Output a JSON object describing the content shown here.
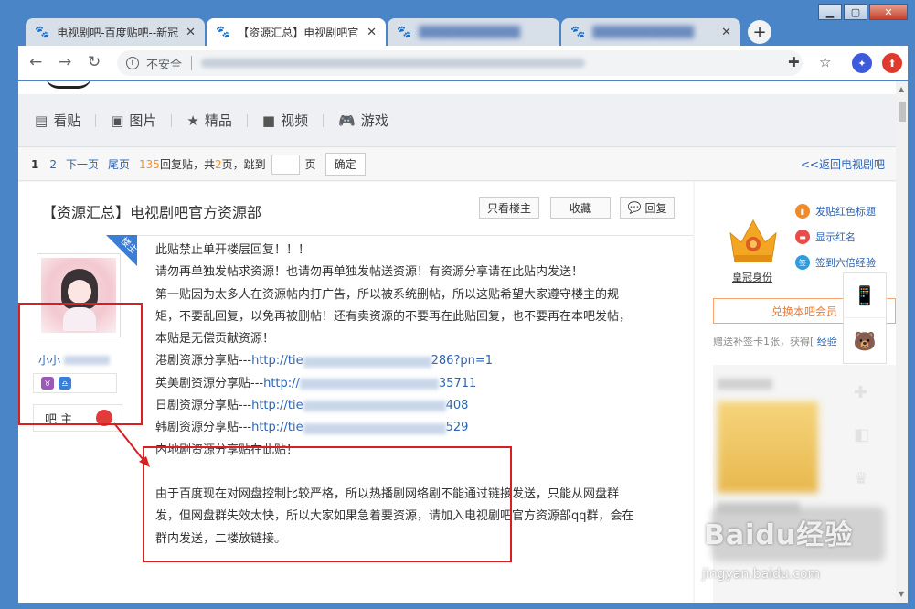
{
  "browser": {
    "tabs": [
      {
        "title": "电视剧吧-百度贴吧--新冠",
        "active": false
      },
      {
        "title": "【资源汇总】电视剧吧官",
        "active": true
      },
      {
        "title": "",
        "active": false
      },
      {
        "title": "",
        "active": false
      }
    ],
    "address": {
      "insecure_label": "不安全"
    }
  },
  "nav": {
    "items": [
      {
        "label": "看贴",
        "icon": "document-icon"
      },
      {
        "label": "图片",
        "icon": "image-icon"
      },
      {
        "label": "精品",
        "icon": "star-icon"
      },
      {
        "label": "视频",
        "icon": "video-icon"
      },
      {
        "label": "游戏",
        "icon": "gamepad-icon"
      }
    ]
  },
  "pager": {
    "page1": "1",
    "page2": "2",
    "next": "下一页",
    "last": "尾页",
    "reply_count": "135",
    "reply_text": "回复贴，共",
    "page_count": "2",
    "page_text": "页，跳到",
    "page_unit": "页",
    "confirm": "确定",
    "back": "<<返回电视剧吧"
  },
  "post": {
    "title": "【资源汇总】电视剧吧官方资源部",
    "only_op": "只看楼主",
    "favorite": "收藏",
    "reply": "回复",
    "op_tag": "楼主",
    "author_prefix": "小小",
    "role": "吧 主",
    "lines": [
      "此贴禁止单开楼层回复！！！",
      "请勿再单独发帖求资源！也请勿再单独发帖送资源！有资源分享请在此贴内发送！",
      "第一贴因为太多人在资源帖内打广告，所以被系统删帖，所以这贴希望大家遵守楼主的规",
      "矩，不要乱回复，以免再被删帖！还有卖资源的不要再在此贴回复，也不要再在本吧发帖，",
      "本贴是无偿贡献资源！"
    ],
    "links": [
      {
        "label": "港剧资源分享贴---",
        "url_start": "http://tie",
        "url_end": "286?pn=1"
      },
      {
        "label": "英美剧资源分享贴---",
        "url_start": "http://",
        "url_end": "35711"
      },
      {
        "label": "日剧资源分享贴---",
        "url_start": "http://tie",
        "url_end": "408"
      },
      {
        "label": "韩剧资源分享贴---",
        "url_start": "http://tie",
        "url_end": "529"
      }
    ],
    "mainland": "内地剧资源分享贴在此贴！",
    "footer_lines": [
      "由于百度现在对网盘控制比较严格，所以热播剧网络剧不能通过链接发送，只能从网盘群",
      "发，但网盘群失效太快，所以大家如果急着要资源，请加入电视剧吧官方资源部qq群，会在",
      "群内发送，二楼放链接。"
    ]
  },
  "sidebar": {
    "crown_label": "皇冠身份",
    "perks": [
      "发贴红色标题",
      "显示红名",
      "签到六倍经验"
    ],
    "vip_button": "兑换本吧会员",
    "sign_note_prefix": "赠送补签卡1张，获得[",
    "sign_note_link": "经验"
  },
  "watermark": {
    "logo": "Baidu经验",
    "url": "jingyan.baidu.com"
  },
  "colors": {
    "link": "#2d64b3",
    "highlight_box": "#d92020",
    "orange": "#f7931e",
    "op_tag": "#3a7fd5"
  }
}
